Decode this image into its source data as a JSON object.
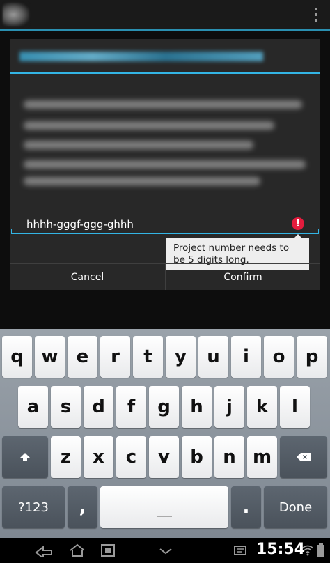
{
  "dialog": {
    "input_value": "hhhh-gggf-ggg-ghhh",
    "error_message": "Project number needs to be 5 digits long.",
    "cancel_label": "Cancel",
    "confirm_label": "Confirm"
  },
  "keyboard": {
    "row1": [
      "q",
      "w",
      "e",
      "r",
      "t",
      "y",
      "u",
      "i",
      "o",
      "p"
    ],
    "row2": [
      "a",
      "s",
      "d",
      "f",
      "g",
      "h",
      "j",
      "k",
      "l"
    ],
    "row3": [
      "z",
      "x",
      "c",
      "v",
      "b",
      "n",
      "m"
    ],
    "symbols_label": "?123",
    "comma_label": ",",
    "period_label": ".",
    "done_label": "Done"
  },
  "status_bar": {
    "time": "15:54"
  },
  "colors": {
    "accent": "#33b5e5",
    "error": "#e31c3d",
    "dialog_bg": "#282828"
  }
}
